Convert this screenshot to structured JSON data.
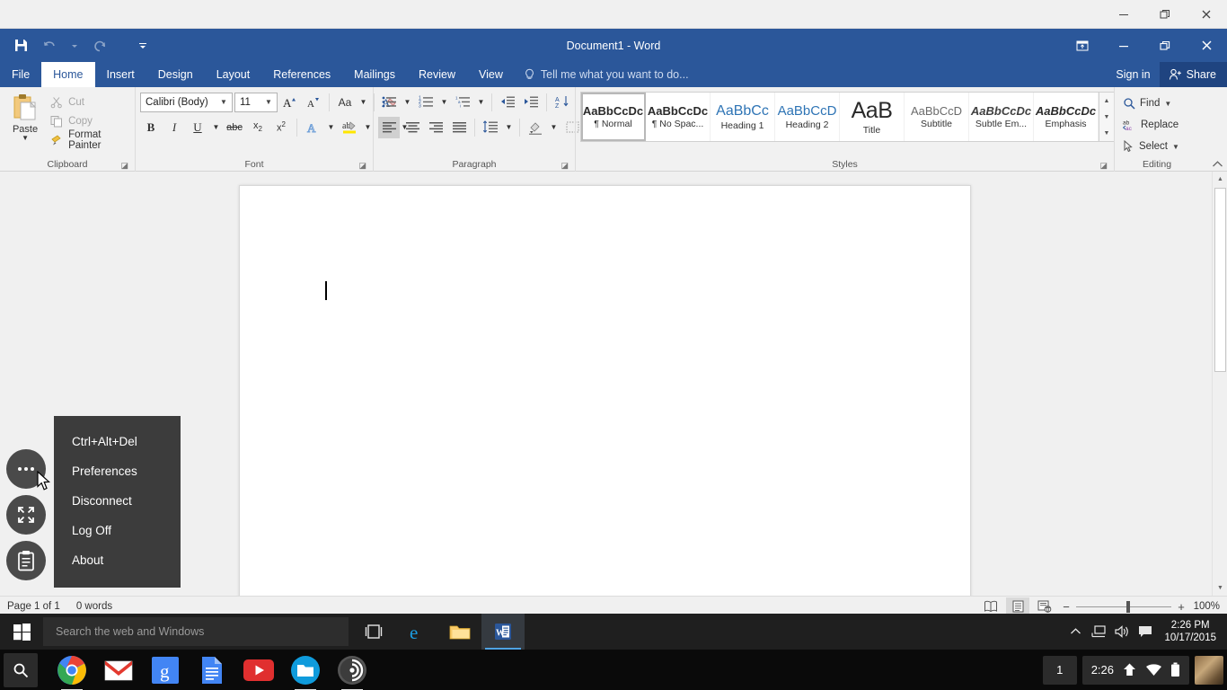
{
  "host_window": {
    "buttons": [
      {
        "name": "minimize",
        "glyph": "—"
      },
      {
        "name": "restore",
        "glyph": "❐"
      },
      {
        "name": "close",
        "glyph": "✕"
      }
    ]
  },
  "word": {
    "title": "Document1 - Word",
    "quick_access": {
      "save_label": "Save",
      "undo_label": "Undo",
      "redo_label": "Repeat",
      "customize_label": "Customize Quick Access Toolbar"
    },
    "window_buttons": [
      {
        "name": "ribbon-display-options",
        "glyph": "⬒"
      },
      {
        "name": "minimize",
        "glyph": "—"
      },
      {
        "name": "restore",
        "glyph": "❐"
      },
      {
        "name": "close",
        "glyph": "✕"
      }
    ],
    "tabs": [
      {
        "label": "File",
        "active": false
      },
      {
        "label": "Home",
        "active": true
      },
      {
        "label": "Insert",
        "active": false
      },
      {
        "label": "Design",
        "active": false
      },
      {
        "label": "Layout",
        "active": false
      },
      {
        "label": "References",
        "active": false
      },
      {
        "label": "Mailings",
        "active": false
      },
      {
        "label": "Review",
        "active": false
      },
      {
        "label": "View",
        "active": false
      }
    ],
    "tell_me": "Tell me what you want to do...",
    "sign_in": "Sign in",
    "share": "Share",
    "groups": {
      "clipboard": {
        "label": "Clipboard",
        "paste": "Paste",
        "items": [
          {
            "label": "Cut",
            "icon": "scissors-icon",
            "enabled": false
          },
          {
            "label": "Copy",
            "icon": "copy-icon",
            "enabled": false
          },
          {
            "label": "Format Painter",
            "icon": "format-painter-icon",
            "enabled": true
          }
        ]
      },
      "font": {
        "label": "Font",
        "font_name": "Calibri (Body)",
        "font_size": "11",
        "buttons_row1": [
          {
            "name": "grow-font",
            "label": "A↑"
          },
          {
            "name": "shrink-font",
            "label": "A↓"
          },
          {
            "name": "change-case",
            "label": "Aa"
          },
          {
            "name": "clear-formatting",
            "label": "Clear All Formatting"
          }
        ],
        "buttons_row2": [
          {
            "name": "bold",
            "label": "B"
          },
          {
            "name": "italic",
            "label": "I"
          },
          {
            "name": "underline",
            "label": "U"
          },
          {
            "name": "strikethrough",
            "label": "abc"
          },
          {
            "name": "subscript",
            "label": "x₂"
          },
          {
            "name": "superscript",
            "label": "x²"
          },
          {
            "name": "text-effects",
            "label": "A"
          },
          {
            "name": "text-highlight-color",
            "label": "ab"
          },
          {
            "name": "font-color",
            "label": "A"
          }
        ]
      },
      "paragraph": {
        "label": "Paragraph",
        "buttons_row1": [
          {
            "name": "bullets",
            "label": "Bullets"
          },
          {
            "name": "numbering",
            "label": "Numbering"
          },
          {
            "name": "multilevel-list",
            "label": "Multilevel List"
          },
          {
            "name": "decrease-indent",
            "label": "Decrease Indent"
          },
          {
            "name": "increase-indent",
            "label": "Increase Indent"
          },
          {
            "name": "sort",
            "label": "Sort"
          },
          {
            "name": "show-formatting-marks",
            "label": "¶"
          }
        ],
        "buttons_row2": [
          {
            "name": "align-left",
            "label": "Align Left"
          },
          {
            "name": "center",
            "label": "Center"
          },
          {
            "name": "align-right",
            "label": "Align Right"
          },
          {
            "name": "justify",
            "label": "Justify"
          },
          {
            "name": "line-spacing",
            "label": "Line and Paragraph Spacing"
          },
          {
            "name": "shading",
            "label": "Shading"
          },
          {
            "name": "borders",
            "label": "Borders"
          }
        ]
      },
      "styles": {
        "label": "Styles",
        "items": [
          {
            "preview": "AaBbCcDc",
            "name": "¶ Normal",
            "selected": true,
            "color": "#2a2a2a",
            "size": "13px",
            "weight": "bold",
            "style": "normal"
          },
          {
            "preview": "AaBbCcDc",
            "name": "¶ No Spac...",
            "selected": false,
            "color": "#2a2a2a",
            "size": "13px",
            "weight": "bold",
            "style": "normal"
          },
          {
            "preview": "AaBbCс",
            "name": "Heading 1",
            "selected": false,
            "color": "#2e74b5",
            "size": "16px",
            "weight": "normal",
            "style": "normal"
          },
          {
            "preview": "AaBbCcD",
            "name": "Heading 2",
            "selected": false,
            "color": "#2e74b5",
            "size": "15px",
            "weight": "normal",
            "style": "normal"
          },
          {
            "preview": "AaB",
            "name": "Title",
            "selected": false,
            "color": "#2a2a2a",
            "size": "25px",
            "weight": "normal",
            "style": "normal"
          },
          {
            "preview": "AaBbCcD",
            "name": "Subtitle",
            "selected": false,
            "color": "#6b6b6b",
            "size": "13px",
            "weight": "normal",
            "style": "normal"
          },
          {
            "preview": "AaBbCcDc",
            "name": "Subtle Em...",
            "selected": false,
            "color": "#404040",
            "size": "13px",
            "weight": "bold",
            "style": "italic"
          },
          {
            "preview": "AaBbCcDc",
            "name": "Emphasis",
            "selected": false,
            "color": "#1a1a1a",
            "size": "13px",
            "weight": "bold",
            "style": "italic"
          }
        ]
      },
      "editing": {
        "label": "Editing",
        "items": [
          {
            "label": "Find",
            "icon": "search-icon",
            "has_caret": true
          },
          {
            "label": "Replace",
            "icon": "replace-icon",
            "has_caret": false
          },
          {
            "label": "Select",
            "icon": "select-pointer-icon",
            "has_caret": true
          }
        ]
      }
    },
    "status_bar": {
      "page": "Page 1 of 1",
      "words": "0 words",
      "views": [
        {
          "name": "read-mode",
          "active": false
        },
        {
          "name": "print-layout",
          "active": true
        },
        {
          "name": "web-layout",
          "active": false
        }
      ],
      "zoom_out": "−",
      "zoom_in": "+",
      "zoom_level": "100%"
    }
  },
  "remote_menu": {
    "items": [
      {
        "label": "Ctrl+Alt+Del"
      },
      {
        "label": "Preferences"
      },
      {
        "label": "Disconnect"
      },
      {
        "label": "Log Off"
      },
      {
        "label": "About"
      }
    ],
    "fabs": [
      {
        "name": "more-options-fab",
        "icon": "ellipsis-icon"
      },
      {
        "name": "fullscreen-fab",
        "icon": "fullscreen-icon"
      },
      {
        "name": "clipboard-fab",
        "icon": "clipboard-icon"
      }
    ]
  },
  "taskbar": {
    "start_label": "Start",
    "search_placeholder": "Search the web and Windows",
    "icons": [
      {
        "name": "task-view",
        "active": false
      },
      {
        "name": "microsoft-edge",
        "active": false
      },
      {
        "name": "file-explorer",
        "active": false
      },
      {
        "name": "microsoft-word",
        "active": true
      }
    ],
    "tray": [
      {
        "name": "show-hidden-icons",
        "glyph": "⌃"
      },
      {
        "name": "network-icon"
      },
      {
        "name": "volume-icon"
      },
      {
        "name": "action-center-icon"
      }
    ],
    "time": "2:26 PM",
    "date": "10/17/2015"
  },
  "shelf": {
    "launcher_label": "Search",
    "apps": [
      {
        "name": "google-chrome",
        "running": true
      },
      {
        "name": "gmail",
        "running": false
      },
      {
        "name": "google-search",
        "running": false
      },
      {
        "name": "google-docs",
        "running": false
      },
      {
        "name": "youtube",
        "running": false
      },
      {
        "name": "files",
        "running": true
      },
      {
        "name": "chrome-remote-desktop",
        "running": true
      }
    ],
    "window_count": "1",
    "time": "2:26",
    "status_icons": [
      {
        "name": "vpn-icon"
      },
      {
        "name": "wifi-icon"
      },
      {
        "name": "battery-icon"
      }
    ]
  }
}
